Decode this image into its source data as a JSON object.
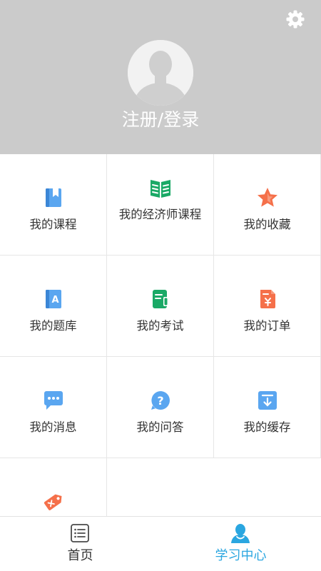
{
  "header": {
    "login_label": "注册/登录",
    "settings_icon": "gear-icon",
    "avatar_icon": "default-avatar",
    "background_color": "#cbcbcb"
  },
  "menu": {
    "items": [
      {
        "label": "我的课程",
        "icon": "book-bookmark-icon",
        "color": "#5aa6f0"
      },
      {
        "label": "我的经济师课程",
        "icon": "open-book-icon",
        "color": "#1aa966"
      },
      {
        "label": "我的收藏",
        "icon": "star-icon",
        "color": "#f5704a"
      },
      {
        "label": "我的题库",
        "icon": "question-bank-icon",
        "color": "#5aa6f0"
      },
      {
        "label": "我的考试",
        "icon": "exam-icon",
        "color": "#1aa966"
      },
      {
        "label": "我的订单",
        "icon": "order-icon",
        "color": "#f5704a"
      },
      {
        "label": "我的消息",
        "icon": "message-icon",
        "color": "#5aa6f0"
      },
      {
        "label": "我的问答",
        "icon": "question-icon",
        "color": "#5aa6f0"
      },
      {
        "label": "我的缓存",
        "icon": "download-icon",
        "color": "#5aa6f0"
      },
      {
        "label": "",
        "icon": "coupon-tag-icon",
        "color": "#f5704a"
      }
    ]
  },
  "tabbar": {
    "tabs": [
      {
        "label": "首页",
        "icon": "home-list-icon",
        "active": false,
        "color": "#333333"
      },
      {
        "label": "学习中心",
        "icon": "user-icon",
        "active": true,
        "color": "#2aa6e0"
      }
    ]
  }
}
